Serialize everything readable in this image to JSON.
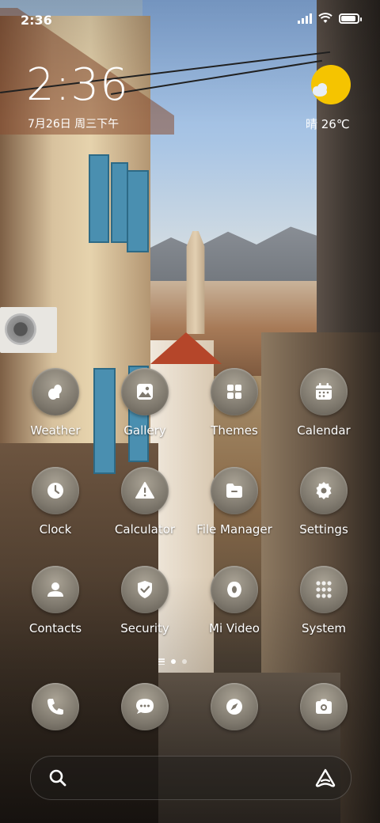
{
  "status_bar": {
    "time": "2:36",
    "battery_percent": 90
  },
  "clock_widget": {
    "time": "2:36",
    "date": "7月26日 周三下午"
  },
  "weather_widget": {
    "text": "晴 26℃",
    "icon": "sun-cloud-icon"
  },
  "apps": [
    {
      "label": "Weather",
      "icon": "weather-icon"
    },
    {
      "label": "Gallery",
      "icon": "gallery-icon"
    },
    {
      "label": "Themes",
      "icon": "themes-icon"
    },
    {
      "label": "Calendar",
      "icon": "calendar-icon"
    },
    {
      "label": "Clock",
      "icon": "clock-icon"
    },
    {
      "label": "Calculator",
      "icon": "calculator-icon"
    },
    {
      "label": "File Manager",
      "icon": "file-manager-icon"
    },
    {
      "label": "Settings",
      "icon": "settings-icon"
    },
    {
      "label": "Contacts",
      "icon": "contacts-icon"
    },
    {
      "label": "Security",
      "icon": "security-icon"
    },
    {
      "label": "Mi Video",
      "icon": "mi-video-icon"
    },
    {
      "label": "System",
      "icon": "system-folder-icon"
    }
  ],
  "page_indicator": {
    "pages": 2,
    "active": 1
  },
  "dock": [
    {
      "icon": "phone-icon"
    },
    {
      "icon": "messages-icon"
    },
    {
      "icon": "browser-icon"
    },
    {
      "icon": "camera-icon"
    }
  ],
  "search_bar": {
    "left_icon": "search-icon",
    "right_icon": "assistant-icon"
  },
  "colors": {
    "icon_bg": "#7e786d",
    "sun": "#f5c400",
    "text": "#ffffff"
  }
}
